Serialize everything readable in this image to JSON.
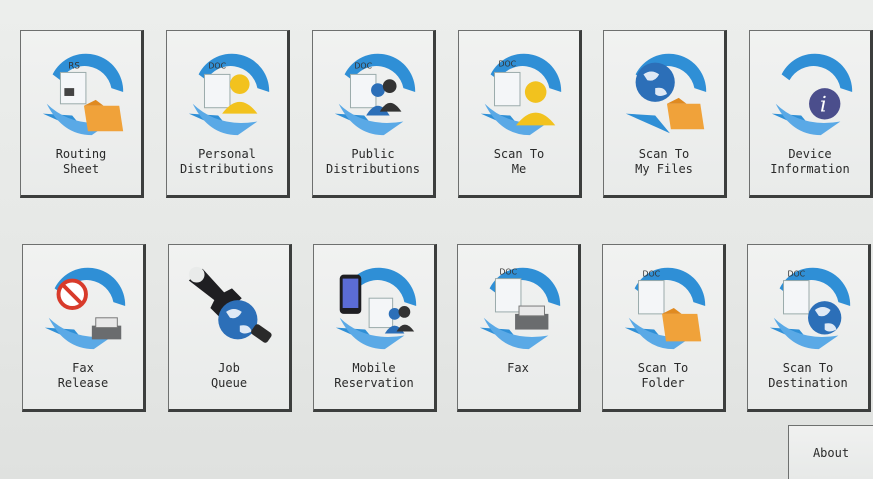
{
  "tiles": [
    {
      "label": "Routing\nSheet",
      "icon": "routing-sheet-icon"
    },
    {
      "label": "Personal\nDistributions",
      "icon": "personal-distributions-icon"
    },
    {
      "label": "Public\nDistributions",
      "icon": "public-distributions-icon"
    },
    {
      "label": "Scan To\nMe",
      "icon": "scan-to-me-icon"
    },
    {
      "label": "Scan To\nMy Files",
      "icon": "scan-to-my-files-icon"
    },
    {
      "label": "Device\nInformation",
      "icon": "device-information-icon"
    },
    {
      "label": "Fax\nRelease",
      "icon": "fax-release-icon"
    },
    {
      "label": "Job\nQueue",
      "icon": "job-queue-icon"
    },
    {
      "label": "Mobile\nReservation",
      "icon": "mobile-reservation-icon"
    },
    {
      "label": "Fax",
      "icon": "fax-icon"
    },
    {
      "label": "Scan To\nFolder",
      "icon": "scan-to-folder-icon"
    },
    {
      "label": "Scan To\nDestination",
      "icon": "scan-to-destination-icon"
    }
  ],
  "about_label": "About",
  "colors": {
    "arrow_blue": "#2f8fd6",
    "folder_orange": "#f0a23a",
    "person_yellow": "#f2c21e",
    "globe_blue": "#2c6fb8"
  }
}
